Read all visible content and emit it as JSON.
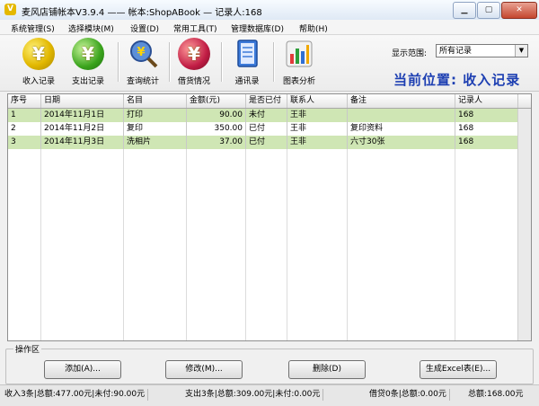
{
  "window": {
    "title": "麦风店铺帐本V3.9.4  ——  帐本:ShopABook — 记录人:168",
    "app_icon": "V"
  },
  "menu": [
    "系统管理(S)",
    "选择模块(M)",
    "设置(D)",
    "常用工具(T)",
    "管理数据库(D)",
    "帮助(H)"
  ],
  "toolbar": [
    {
      "label": "收入记录",
      "icon": "yen-coin-arrow-icon"
    },
    {
      "label": "支出记录",
      "icon": "yen-coin-green-icon"
    },
    {
      "label": "查询统计",
      "icon": "magnifier-report-icon"
    },
    {
      "label": "借货情况",
      "icon": "yen-exchange-icon"
    },
    {
      "label": "通讯录",
      "icon": "address-book-icon"
    },
    {
      "label": "图表分析",
      "icon": "bar-chart-icon"
    }
  ],
  "range": {
    "label": "显示范围:",
    "value": "所有记录"
  },
  "location": "当前位置: 收入记录",
  "table": {
    "headers": [
      "序号",
      "日期",
      "名目",
      "金额(元)",
      "是否已付",
      "联系人",
      "备注",
      "记录人"
    ],
    "rows": [
      [
        "1",
        "2014年11月1日",
        "打印",
        "90.00",
        "未付",
        "王非",
        "",
        "168"
      ],
      [
        "2",
        "2014年11月2日",
        "复印",
        "350.00",
        "已付",
        "王非",
        "复印资料",
        "168"
      ],
      [
        "3",
        "2014年11月3日",
        "洗相片",
        "37.00",
        "已付",
        "王非",
        "六寸30张",
        "168"
      ]
    ]
  },
  "ops": {
    "title": "操作区",
    "buttons": [
      "添加(A)...",
      "修改(M)...",
      "删除(D)",
      "生成Excel表(E)..."
    ]
  },
  "status": [
    "收入3条|总额:477.00元|未付:90.00元",
    "支出3条|总额:309.00元|未付:0.00元",
    "借贷0条|总额:0.00元",
    "总额:168.00元"
  ]
}
